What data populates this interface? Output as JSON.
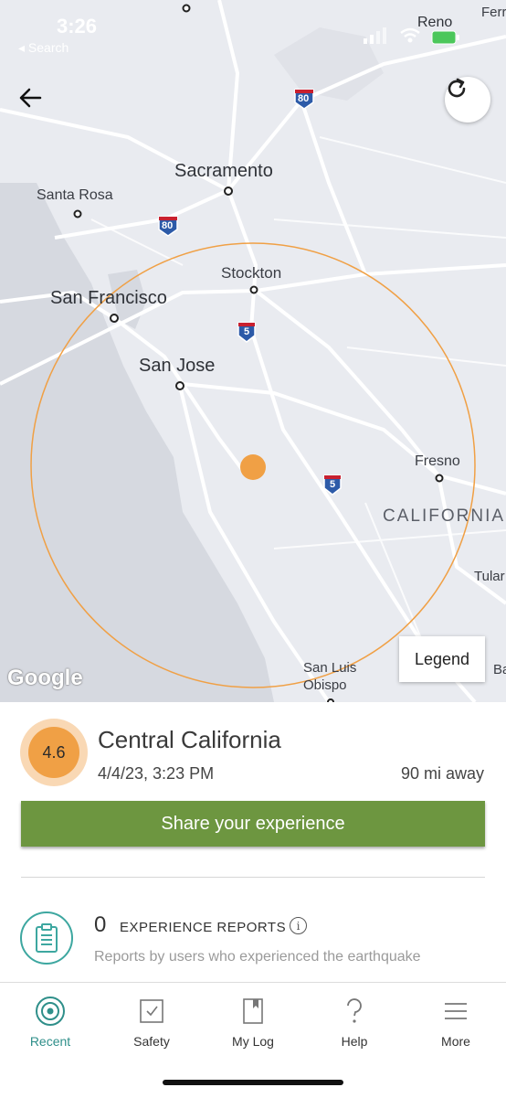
{
  "status_bar": {
    "time": "3:26",
    "back_label": "◂ Search"
  },
  "map": {
    "cities": [
      {
        "name": "Sacramento"
      },
      {
        "name": "Santa Rosa"
      },
      {
        "name": "Stockton"
      },
      {
        "name": "San Francisco"
      },
      {
        "name": "San Jose"
      },
      {
        "name": "Fresno"
      },
      {
        "name": "Reno"
      },
      {
        "name": "San Luis Obispo"
      },
      {
        "name": "Tular"
      },
      {
        "name": "Ferr"
      },
      {
        "name": "Ba"
      }
    ],
    "region_label": "CALIFORNIA",
    "highway_shields": [
      "80",
      "80",
      "5",
      "5"
    ],
    "attribution": "Google",
    "legend_label": "Legend",
    "accent_color": "#f0a045"
  },
  "event": {
    "magnitude": "4.6",
    "place": "Central California",
    "datetime": "4/4/23, 3:23 PM",
    "distance": "90 mi away",
    "share_label": "Share your experience"
  },
  "reports": {
    "count": "0",
    "title": "EXPERIENCE REPORTS",
    "description": "Reports by users who experienced the earthquake"
  },
  "tabs": [
    {
      "label": "Recent",
      "icon": "target-icon",
      "active": true
    },
    {
      "label": "Safety",
      "icon": "checkbox-icon",
      "active": false
    },
    {
      "label": "My Log",
      "icon": "bookmark-book-icon",
      "active": false
    },
    {
      "label": "Help",
      "icon": "question-icon",
      "active": false
    },
    {
      "label": "More",
      "icon": "menu-icon",
      "active": false
    }
  ],
  "colors": {
    "brand_green": "#6d9640",
    "teal": "#2f8f8a"
  }
}
